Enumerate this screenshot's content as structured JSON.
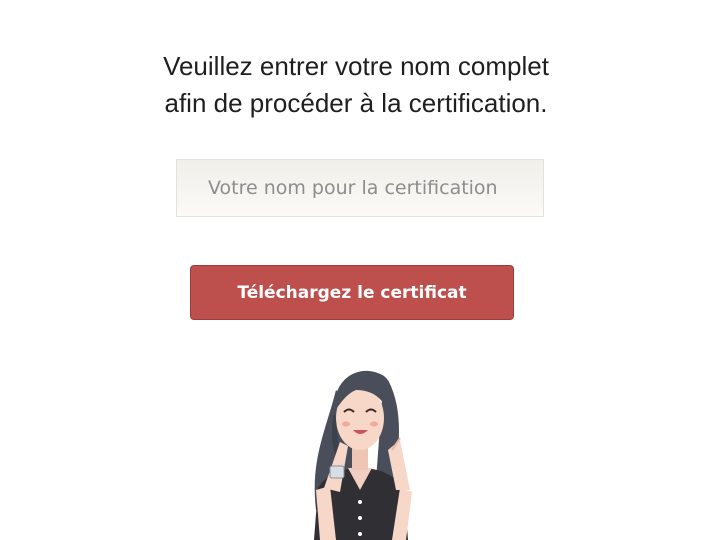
{
  "prompt": {
    "line1": "Veuillez entrer votre nom complet",
    "line2": "afin de procéder à la certification."
  },
  "name_input": {
    "placeholder": "Votre nom pour la certification",
    "value": ""
  },
  "download_button": {
    "label": "Téléchargez le certificat"
  },
  "colors": {
    "button": "#bd4f4c",
    "input_background": "#f3f2ee",
    "text": "#1f1f1f",
    "placeholder": "#8d8d8d"
  },
  "illustration": {
    "icon": "clapping-woman-illustration"
  }
}
